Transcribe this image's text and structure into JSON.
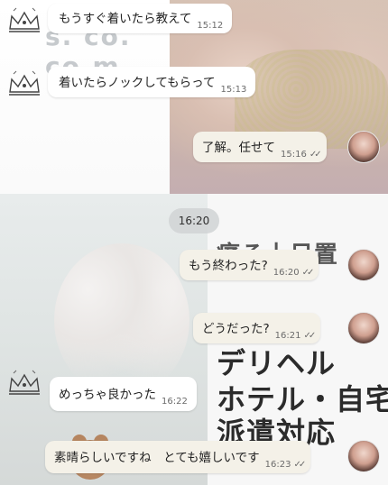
{
  "background_ad": {
    "top_fragment": "s. co. co.m",
    "line1": "痛る上日置",
    "line2": "デリヘル",
    "line3": "ホテル・自宅",
    "line4": "派遣対応"
  },
  "date_divider": "16:20",
  "messages": [
    {
      "text": "もうすぐ着いたら教えて",
      "time": "15:12"
    },
    {
      "text": "着いたらノックしてもらって",
      "time": "15:13"
    },
    {
      "text": "了解。任せて",
      "time": "15:16",
      "read": "✓✓"
    },
    {
      "text": "もう終わった?",
      "time": "16:20",
      "read": "✓✓"
    },
    {
      "text": "どうだった?",
      "time": "16:21",
      "read": "✓✓"
    },
    {
      "text": "めっちゃ良かった",
      "time": "16:22"
    },
    {
      "text": "素晴らしいですね　とても嬉しいです",
      "time": "16:23",
      "read": "✓✓"
    }
  ]
}
